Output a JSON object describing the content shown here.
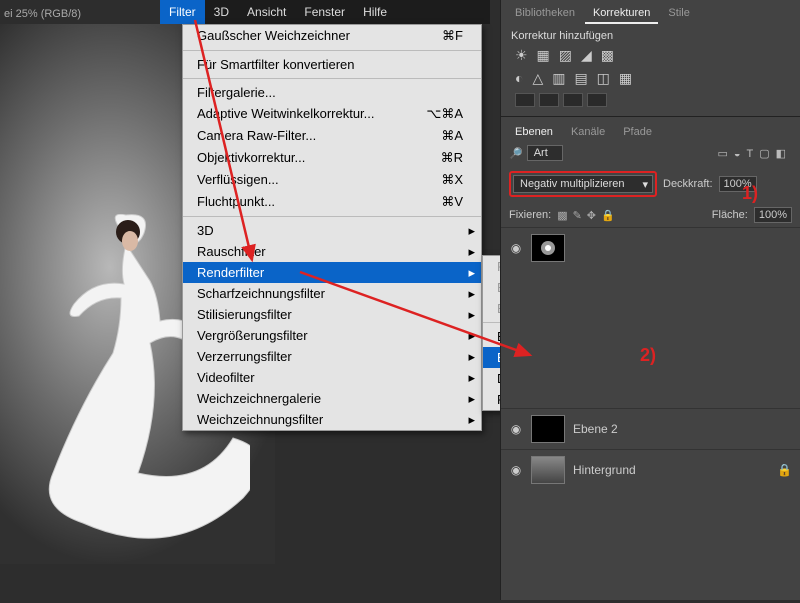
{
  "doc_label": "ei 25% (RGB/8)",
  "menubar": {
    "filter": "Filter",
    "dd": "3D",
    "ansicht": "Ansicht",
    "fenster": "Fenster",
    "hilfe": "Hilfe"
  },
  "filter_menu": {
    "row1": {
      "label": "Gaußscher Weichzeichner",
      "key": "⌘F"
    },
    "row2": {
      "label": "Für Smartfilter konvertieren"
    },
    "row3": {
      "label": "Filtergalerie..."
    },
    "row4": {
      "label": "Adaptive Weitwinkelkorrektur...",
      "key": "⌥⌘A"
    },
    "row5": {
      "label": "Camera Raw-Filter...",
      "key": "⌘A"
    },
    "row6": {
      "label": "Objektivkorrektur...",
      "key": "⌘R"
    },
    "row7": {
      "label": "Verflüssigen...",
      "key": "⌘X"
    },
    "row8": {
      "label": "Fluchtpunkt...",
      "key": "⌘V"
    },
    "row9": {
      "label": "3D"
    },
    "row10": {
      "label": "Rauschfilter"
    },
    "row11": {
      "label": "Renderfilter"
    },
    "row12": {
      "label": "Scharfzeichnungsfilter"
    },
    "row13": {
      "label": "Stilisierungsfilter"
    },
    "row14": {
      "label": "Vergrößerungsfilter"
    },
    "row15": {
      "label": "Verzerrungsfilter"
    },
    "row16": {
      "label": "Videofilter"
    },
    "row17": {
      "label": "Weichzeichnergalerie"
    },
    "row18": {
      "label": "Weichzeichnungsfilter"
    }
  },
  "submenu": {
    "r1": "Flamme…",
    "r2": "Bilderrahmen…",
    "r3": "Baum…",
    "r4": "Beleuchtungseffekte…",
    "r5": "Blendenflecke…",
    "r6": "Differenz-Wolken",
    "r7": "Fasern…"
  },
  "right": {
    "tabs": {
      "bib": "Bibliotheken",
      "korr": "Korrekturen",
      "stile": "Stile"
    },
    "korr_add": "Korrektur hinzufügen",
    "sec_tabs": {
      "ebenen": "Ebenen",
      "kanale": "Kanäle",
      "pfade": "Pfade"
    },
    "search_value": "Art",
    "blend_mode": "Negativ multiplizieren",
    "deckkraft_label": "Deckkraft:",
    "deckkraft_val": "100%",
    "fix_label": "Fixieren:",
    "flache_label": "Fläche:",
    "flache_val": "100%",
    "layer2": "Ebene 2",
    "layer_bg": "Hintergrund"
  },
  "anno": {
    "n1": "1)",
    "n2": "2)"
  }
}
